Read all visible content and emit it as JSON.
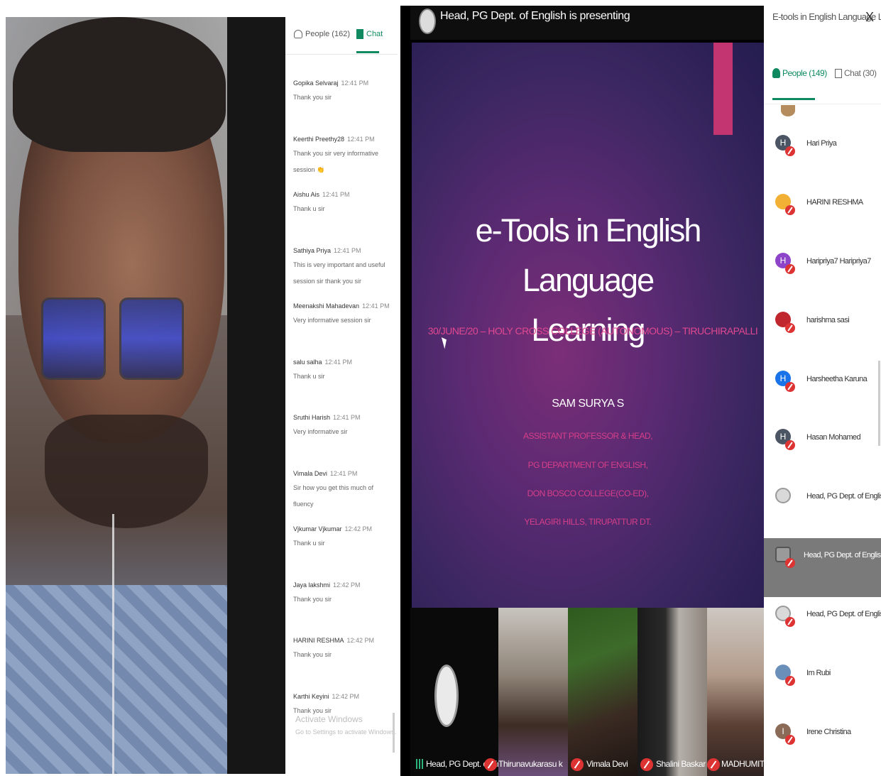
{
  "left_screen": {
    "chat_tabs": {
      "people_label": "People (162)",
      "chat_label": "Chat"
    },
    "messages": [
      {
        "sender": "Gopika Selvaraj",
        "time": "12:41 PM",
        "text": "Thank you sir"
      },
      {
        "sender": "Keerthi Preethy28",
        "time": "12:41 PM",
        "text": "Thank you sir very informative session 👏"
      },
      {
        "sender": "Aishu Ais",
        "time": "12:41 PM",
        "text": "Thank u sir"
      },
      {
        "sender": "Sathiya Priya",
        "time": "12:41 PM",
        "text": "This is very important and useful session sir thank you sir"
      },
      {
        "sender": "Meenakshi Mahadevan",
        "time": "12:41 PM",
        "text": "Very informative session sir"
      },
      {
        "sender": "salu salha",
        "time": "12:41 PM",
        "text": "Thank u sir"
      },
      {
        "sender": "Sruthi Harish",
        "time": "12:41 PM",
        "text": "Very informative sir"
      },
      {
        "sender": "Vimala Devi",
        "time": "12:41 PM",
        "text": "Sir how you get this much of fluency"
      },
      {
        "sender": "Vjkumar Vjkumar",
        "time": "12:42 PM",
        "text": "Thank u sir"
      },
      {
        "sender": "Jaya lakshmi",
        "time": "12:42 PM",
        "text": "Thank you sir"
      },
      {
        "sender": "HARINI RESHMA",
        "time": "12:42 PM",
        "text": "Thank you sir"
      },
      {
        "sender": "Karthi Keyini",
        "time": "12:42 PM",
        "text": "Thank you sir"
      }
    ],
    "watermark": {
      "title": "Activate Windows",
      "subtitle": "Go to Settings to activate Windows."
    }
  },
  "right_screen": {
    "presenting_text": "Head, PG Dept. of English is presenting",
    "slide": {
      "title_line1": "e-Tools in English Language",
      "title_line2": "Learning",
      "subtitle": "30/JUNE/20 – HOLY CROSS COLLEGE (AUTONOMOUS) – TIRUCHIRAPALLI",
      "author": "SAM SURYA S",
      "lines": [
        "ASSISTANT PROFESSOR & HEAD,",
        "PG DEPARTMENT OF ENGLISH,",
        "DON BOSCO COLLEGE(CO-ED),",
        "YELAGIRI HILLS, TIRUPATTUR DT."
      ]
    },
    "tiles": [
      {
        "name": "Head, PG Dept. of Eng..."
      },
      {
        "name": "Thirunavukarasu k"
      },
      {
        "name": "Vimala Devi"
      },
      {
        "name": "Shalini Baskar"
      },
      {
        "name": "MADHUMITHA G"
      }
    ],
    "people_panel": {
      "meeting_title": "E-tools in English Language Lear...",
      "close_symbol": "X",
      "people_tab": "People (149)",
      "chat_tab": "Chat (30)",
      "participants": [
        {
          "initial": "H",
          "name": "Hari Priya",
          "color": "#4b5563"
        },
        {
          "initial": "",
          "name": "HARINI RESHMA",
          "color": "#f2b134"
        },
        {
          "initial": "H",
          "name": "Haripriya7 Haripriya7",
          "color": "#8e44c9"
        },
        {
          "initial": "",
          "name": "harishma sasi",
          "color": "#c0262d"
        },
        {
          "initial": "H",
          "name": "Harsheetha Karuna",
          "color": "#1a73e8"
        },
        {
          "initial": "H",
          "name": "Hasan Mohamed",
          "color": "#4b5563"
        },
        {
          "initial": "",
          "name": "Head, PG Dept. of English",
          "color": "#d9d9d9"
        },
        {
          "initial": "",
          "name": "Head, PG Dept. of English (Pre...",
          "color": "#9a9a9a"
        },
        {
          "initial": "",
          "name": "Head, PG Dept. of English",
          "color": "#d9d9d9"
        },
        {
          "initial": "",
          "name": "Im Rubi",
          "color": "#6a8fb8"
        },
        {
          "initial": "I",
          "name": "Irene Christina",
          "color": "#8b6a58"
        }
      ]
    }
  }
}
